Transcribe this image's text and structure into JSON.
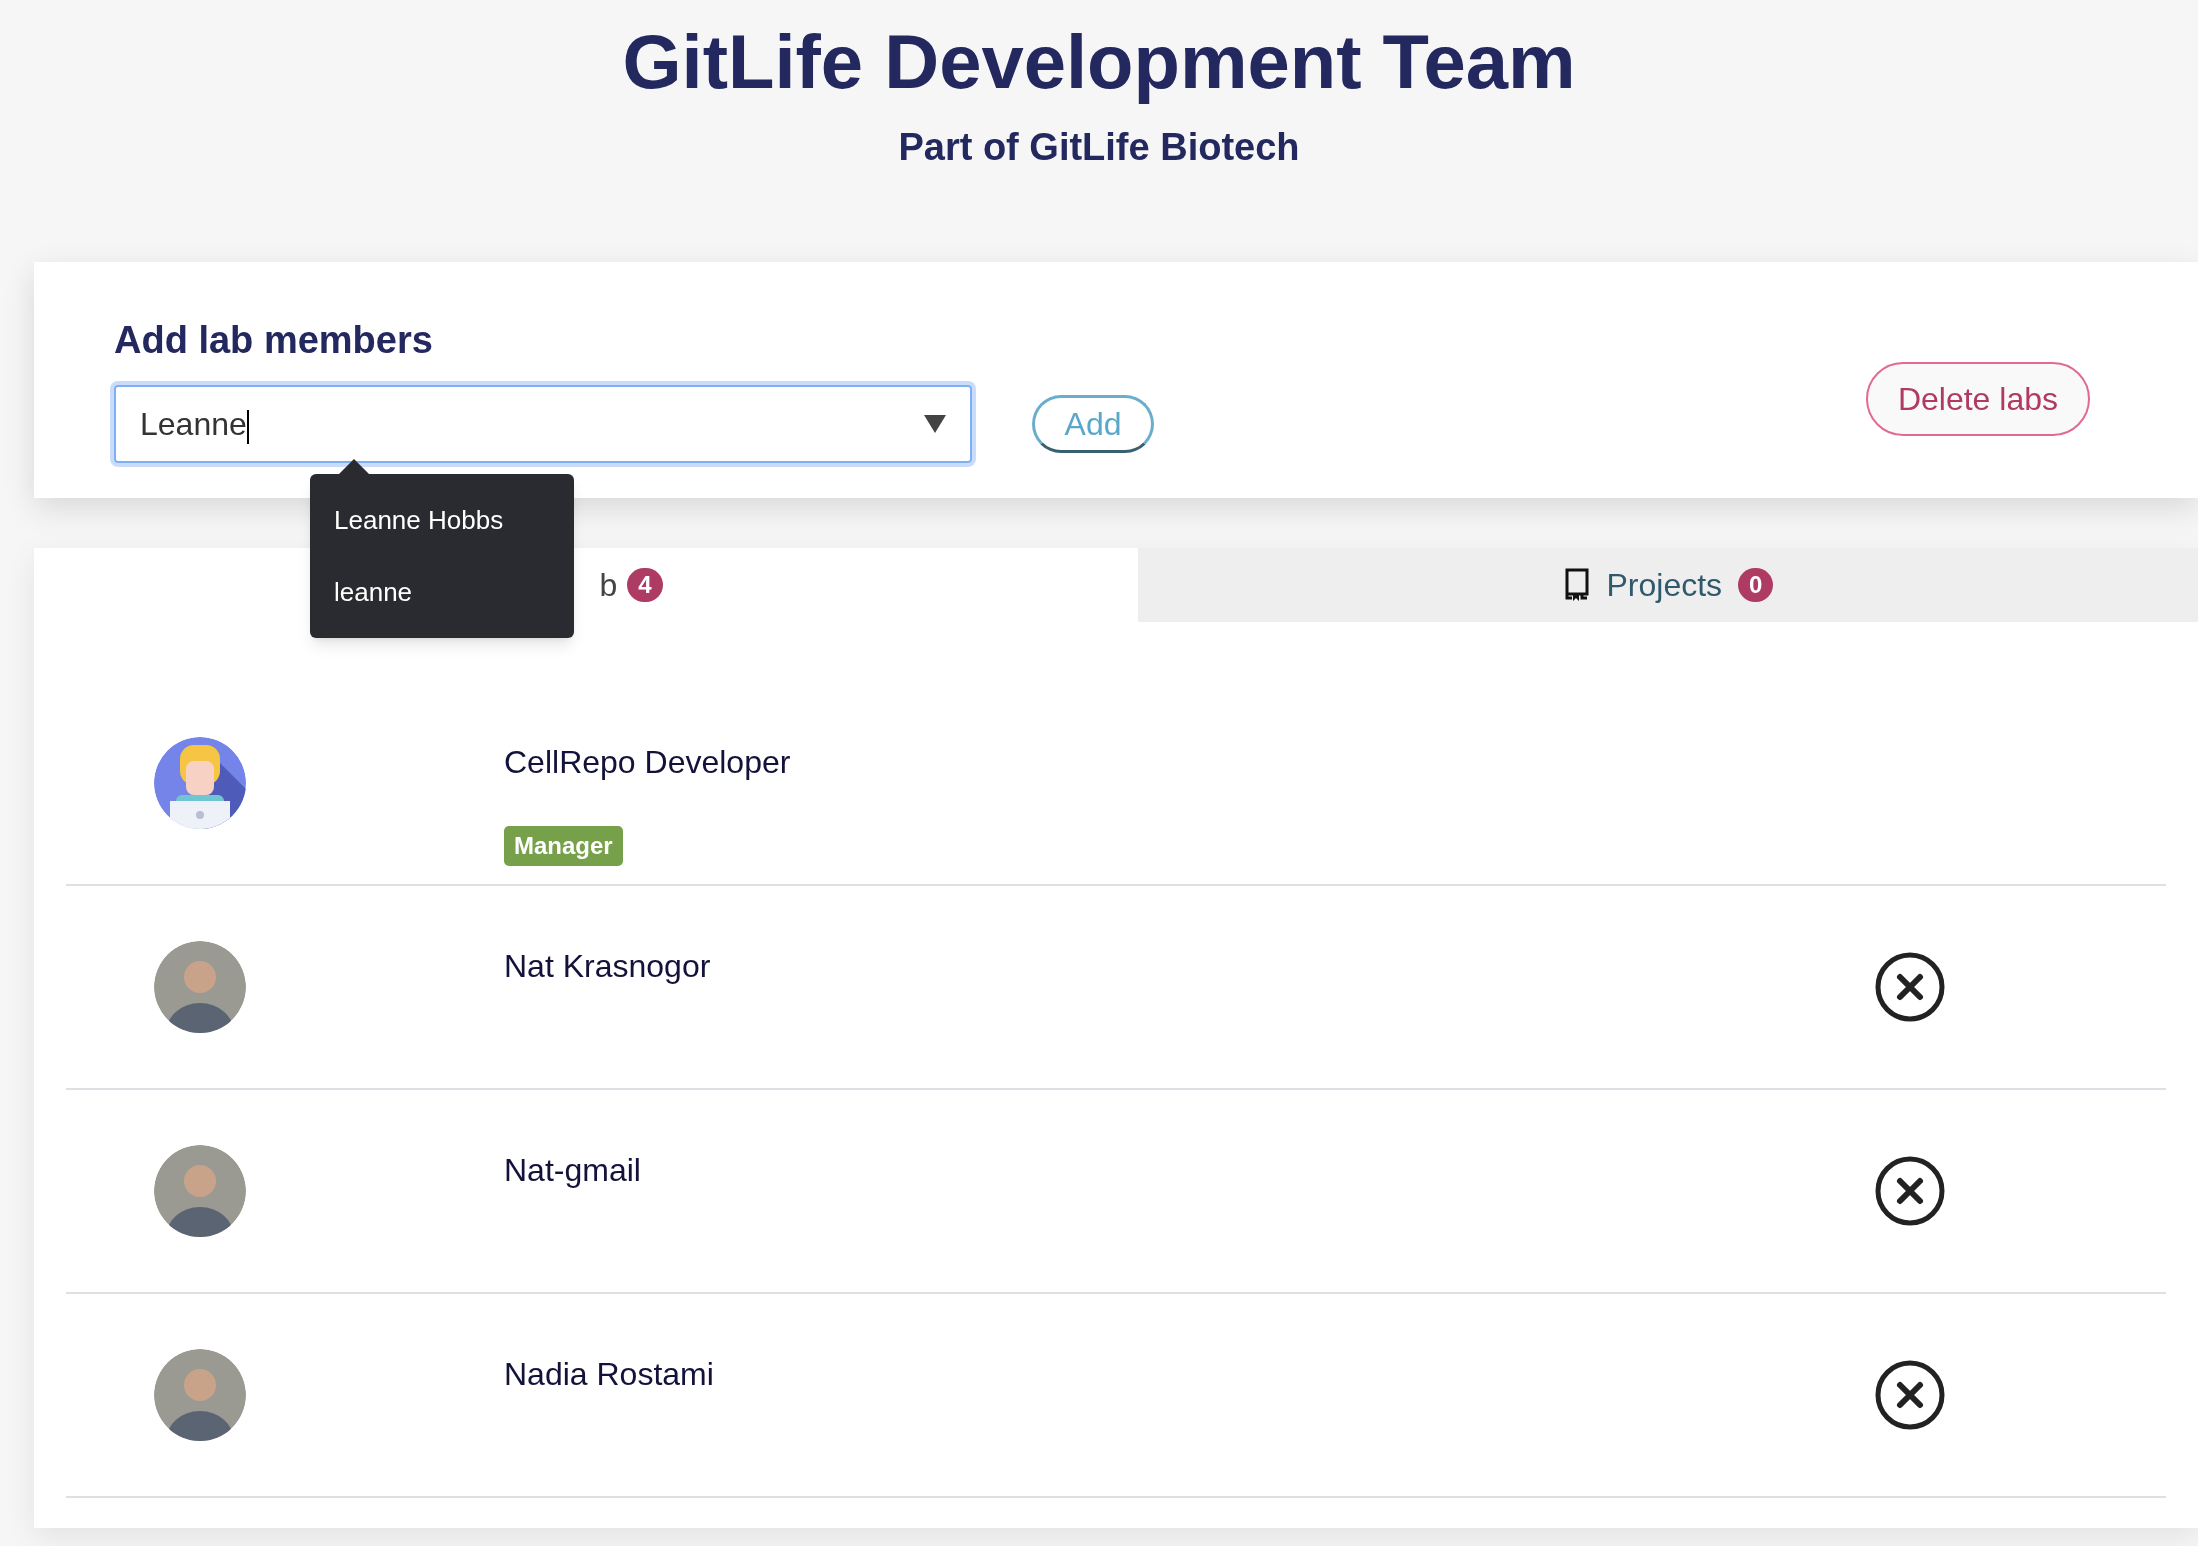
{
  "header": {
    "title": "GitLife Development Team",
    "subtitle": "Part of GitLife Biotech"
  },
  "add_members": {
    "heading": "Add lab members",
    "value": "Leanne",
    "add_button": "Add",
    "delete_button": "Delete labs",
    "suggestions": [
      "Leanne Hobbs",
      "leanne"
    ]
  },
  "tabs": [
    {
      "label": "b",
      "count": "4",
      "selected": true,
      "kind": "plain"
    },
    {
      "label": "Projects",
      "count": "0",
      "selected": false,
      "kind": "book"
    }
  ],
  "members": [
    {
      "name": "CellRepo Developer",
      "badge": "Manager",
      "removable": false,
      "kind": "illustration"
    },
    {
      "name": "Nat Krasnogor",
      "removable": true,
      "kind": "photo"
    },
    {
      "name": "Nat-gmail",
      "removable": true,
      "kind": "photo"
    },
    {
      "name": "Nadia Rostami",
      "removable": true,
      "kind": "photo"
    }
  ]
}
